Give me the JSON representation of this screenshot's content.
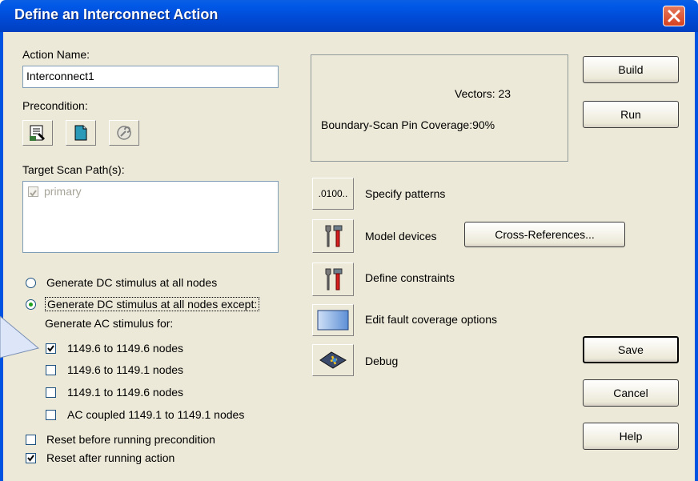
{
  "window": {
    "title": "Define an Interconnect Action"
  },
  "action_name": {
    "label": "Action Name:",
    "value": "Interconnect1"
  },
  "precondition": {
    "label": "Precondition:",
    "icons": [
      "edit-precondition-icon",
      "document-icon",
      "gear-icon"
    ]
  },
  "scan_paths": {
    "label": "Target Scan Path(s):",
    "items": [
      {
        "label": "primary",
        "checked": true
      }
    ]
  },
  "stimulus": {
    "option_all": "Generate DC stimulus at all nodes",
    "option_except": "Generate DC stimulus at all nodes except:",
    "selected": "except",
    "ac_label": "Generate AC stimulus for:",
    "ac_items": [
      {
        "label": "1149.6 to 1149.6 nodes",
        "checked": true
      },
      {
        "label": "1149.6 to 1149.1 nodes",
        "checked": false
      },
      {
        "label": "1149.1 to 1149.6 nodes",
        "checked": false
      },
      {
        "label": "AC coupled 1149.1 to 1149.1 nodes",
        "checked": false
      }
    ]
  },
  "reset": {
    "before": {
      "label": "Reset before running precondition",
      "checked": false
    },
    "after": {
      "label": "Reset after running action",
      "checked": true
    }
  },
  "stats": {
    "vectors": "Vectors: 23",
    "coverage": "Boundary-Scan Pin Coverage:90%"
  },
  "tools": {
    "patterns_btn": ".0100..",
    "patterns_label": "Specify patterns",
    "model_label": "Model devices",
    "crossref_btn": "Cross-References...",
    "constraints_label": "Define constraints",
    "fault_label": "Edit fault coverage options",
    "debug_label": "Debug"
  },
  "buttons": {
    "build": "Build",
    "run": "Run",
    "save": "Save",
    "cancel": "Cancel",
    "help": "Help"
  },
  "colors": {
    "titlebar": "#0058e6",
    "dialog_bg": "#ece9d8",
    "close": "#d6411f"
  }
}
